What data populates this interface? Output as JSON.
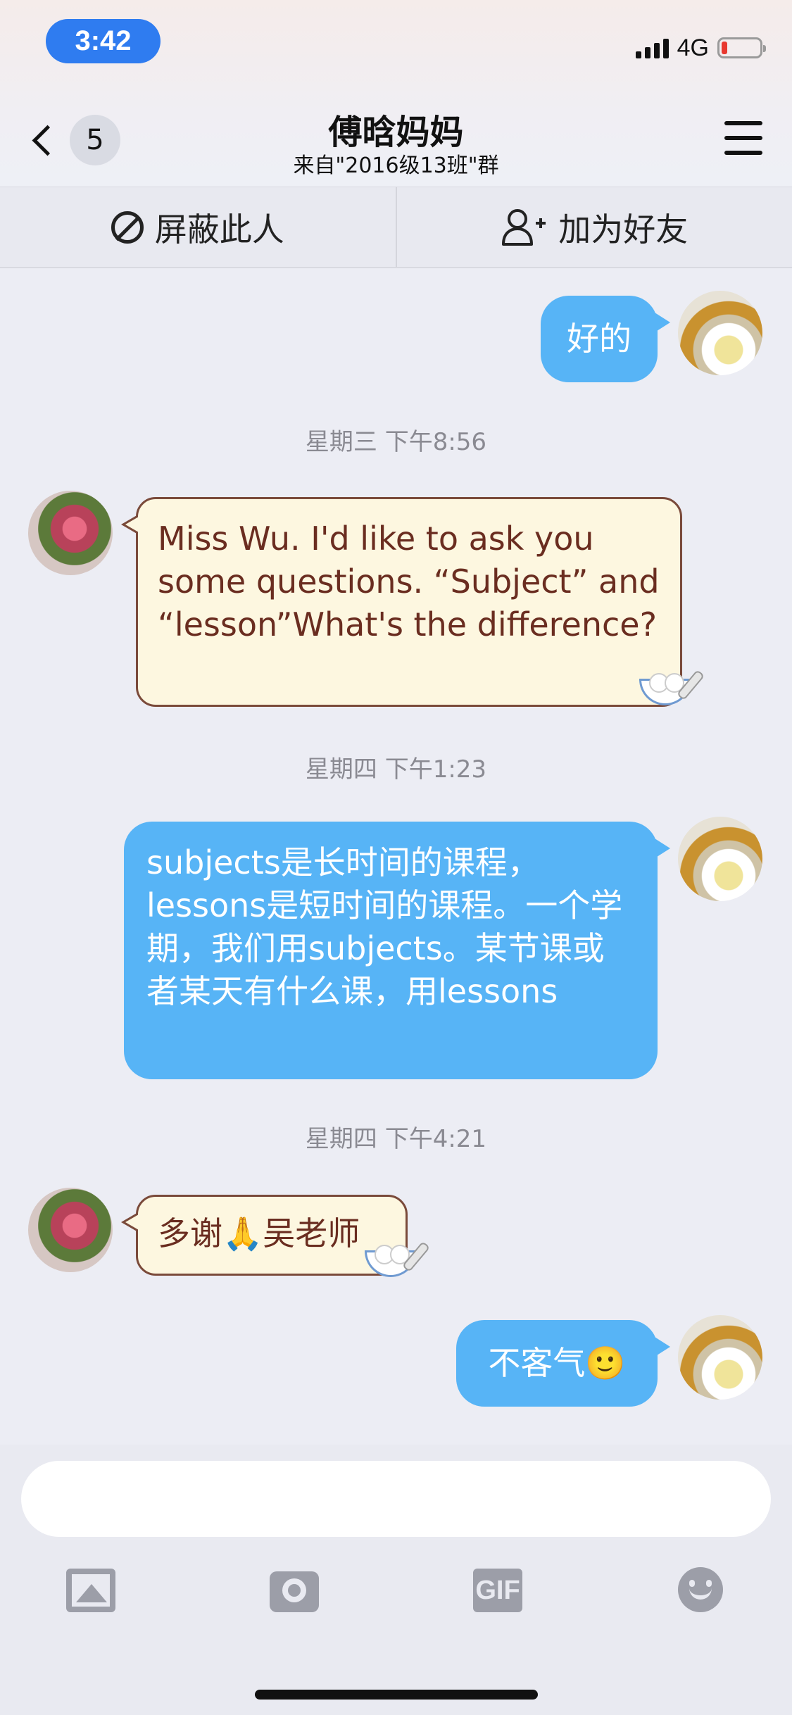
{
  "status_bar": {
    "time": "3:42",
    "network": "4G",
    "battery_level": 0.15
  },
  "header": {
    "back_count": "5",
    "title": "傅晗妈妈",
    "subtitle": "来自\"2016级13班\"群",
    "icons": [
      "back-chevron-icon",
      "menu-icon"
    ]
  },
  "actions": {
    "block_label": "屏蔽此人",
    "add_friend_label": "加为好友"
  },
  "messages": [
    {
      "sender": "self",
      "text": "好的"
    },
    {
      "timestamp": "星期三 下午8:56"
    },
    {
      "sender": "other",
      "text": "Miss Wu. I'd like to ask you some questions. “Subject” and “lesson”What's the difference?"
    },
    {
      "timestamp": "星期四 下午1:23"
    },
    {
      "sender": "self",
      "text": "subjects是长时间的课程，lessons是短时间的课程。一个学期，我们用subjects。某节课或者某天有什么课，用lessons"
    },
    {
      "timestamp": "星期四 下午4:21"
    },
    {
      "sender": "other",
      "text": "多谢🙏吴老师"
    },
    {
      "sender": "self",
      "text": "不客气🙂"
    }
  ],
  "composer": {
    "value": "",
    "placeholder": "",
    "tools": [
      "image-icon",
      "camera-icon",
      "gif-icon",
      "emoji-icon"
    ],
    "gif_label": "GIF"
  },
  "colors": {
    "self_bubble": "#57b4f6",
    "other_bubble": "#fdf7e0",
    "other_text": "#6a2d20",
    "accent": "#2f7cf0"
  }
}
